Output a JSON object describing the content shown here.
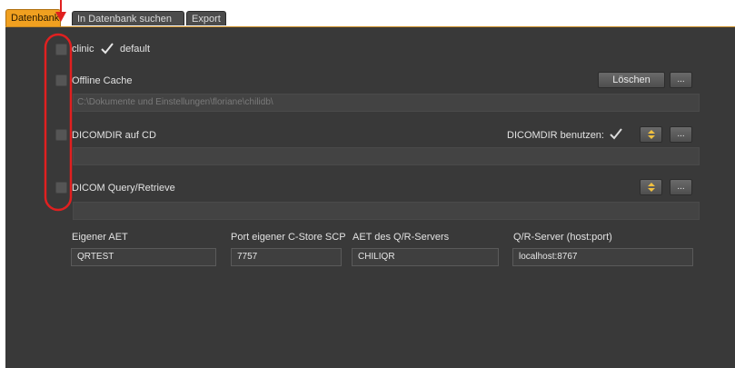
{
  "tabs": [
    {
      "label": "Datenbank"
    },
    {
      "label": "In Datenbank suchen"
    },
    {
      "label": "Export"
    }
  ],
  "sections": {
    "clinic": {
      "label": "clinic",
      "default_label": "default"
    },
    "offline_cache": {
      "label": "Offline Cache",
      "delete_label": "Löschen",
      "browse_label": "...",
      "path": "C:\\Dokumente und Einstellungen\\floriane\\chilidb\\"
    },
    "dicomdir": {
      "label": "DICOMDIR auf CD",
      "use_label": "DICOMDIR benutzen:",
      "browse_label": "..."
    },
    "query": {
      "label": "DICOM Query/Retrieve",
      "browse_label": "..."
    }
  },
  "fields": {
    "own_aet": {
      "label": "Eigener AET",
      "value": "QRTEST"
    },
    "store_port": {
      "label": "Port eigener C-Store SCP",
      "value": "7757"
    },
    "qr_aet": {
      "label": "AET des Q/R-Servers",
      "value": "CHILIQR"
    },
    "qr_server": {
      "label": "Q/R-Server (host:port)",
      "value": "localhost:8767"
    }
  },
  "colors": {
    "accent": "#f0a020",
    "annotation": "#e02020",
    "panel": "#393939"
  },
  "icons": {
    "check": "check-icon",
    "spin": "spinner-icon",
    "arrow": "arrow-down-icon"
  }
}
